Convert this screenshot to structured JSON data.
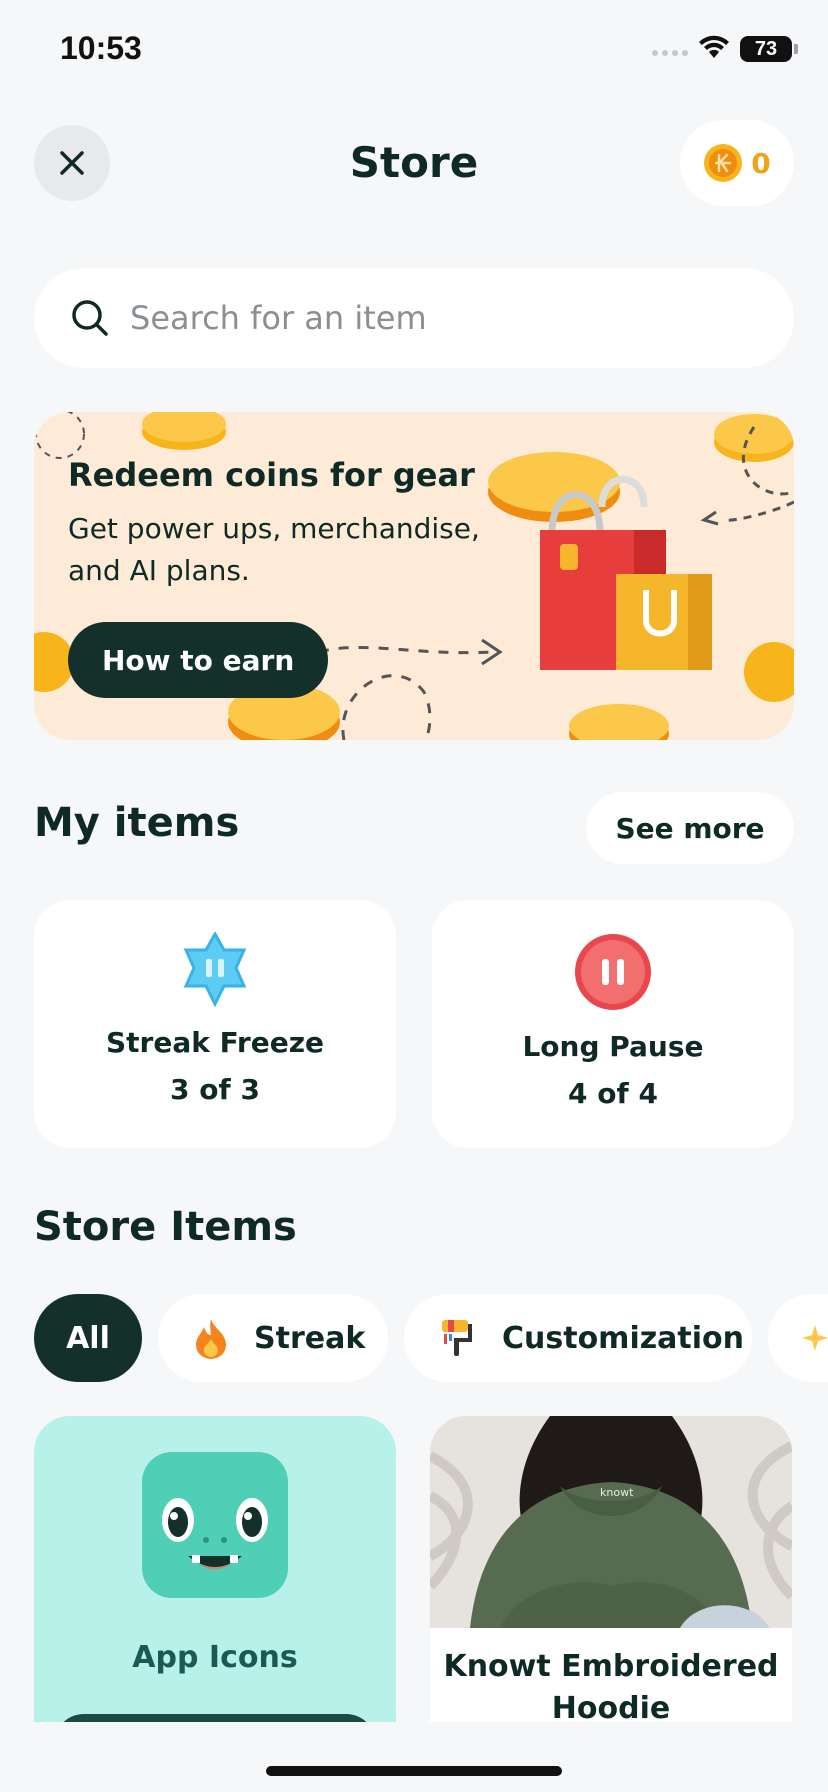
{
  "status_bar": {
    "time": "10:53",
    "battery": "73"
  },
  "header": {
    "title": "Store",
    "coin_balance": "0"
  },
  "search": {
    "placeholder": "Search for an item",
    "value": ""
  },
  "promo": {
    "title": "Redeem coins for gear",
    "text": "Get power ups, merchandise, and AI plans.",
    "button_label": "How to earn"
  },
  "my_items": {
    "title": "My items",
    "see_more_label": "See more",
    "items": [
      {
        "name": "Streak Freeze",
        "count": "3 of 3",
        "icon": "streak-freeze-icon"
      },
      {
        "name": "Long Pause",
        "count": "4 of 4",
        "icon": "long-pause-icon"
      }
    ]
  },
  "store_items": {
    "title": "Store Items",
    "filters": [
      {
        "label": "All",
        "active": true
      },
      {
        "label": "Streak",
        "icon": "flame-icon"
      },
      {
        "label": "Customization",
        "icon": "paint-roller-icon"
      },
      {
        "label": "",
        "icon": "sparkle-icon"
      }
    ],
    "cards": [
      {
        "label": "App Icons",
        "icon": "app-mascot-icon"
      },
      {
        "label": "Knowt Embroidered Hoodie",
        "image": "hoodie-photo",
        "print": "knowt"
      }
    ]
  },
  "colors": {
    "background": "#f5f7f9",
    "dark_accent": "#13302a",
    "promo_bg": "#fdebd8",
    "coin": "#f0a317",
    "app_card_bg": "#b7f1ea"
  }
}
